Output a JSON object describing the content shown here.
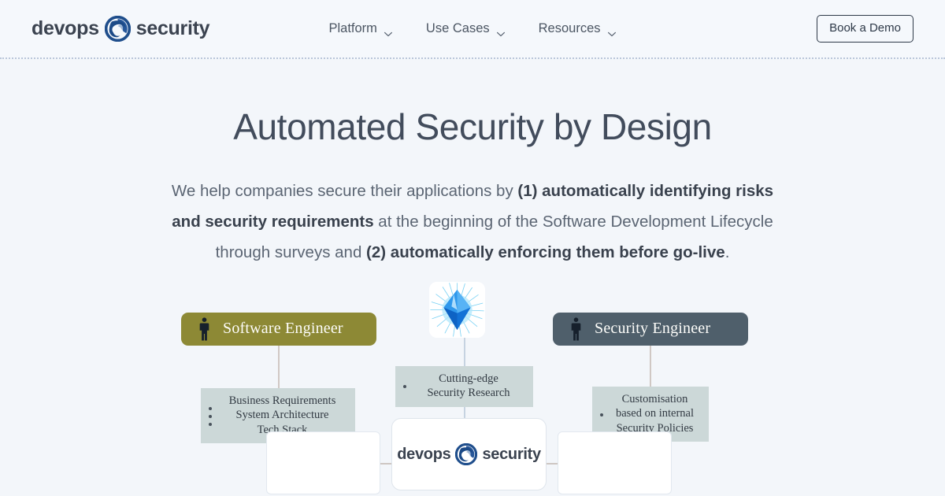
{
  "header": {
    "brand": {
      "left_word": "devops",
      "right_word": "security",
      "mark_icon": "swirl-logo-icon"
    },
    "nav": [
      {
        "label": "Platform",
        "icon": "chevron-down-icon"
      },
      {
        "label": "Use Cases",
        "icon": "chevron-down-icon"
      },
      {
        "label": "Resources",
        "icon": "chevron-down-icon"
      }
    ],
    "cta": {
      "label": "Book a Demo"
    }
  },
  "hero": {
    "title": "Automated Security by Design",
    "subtitle": {
      "part1": "We help companies secure their applications by ",
      "bold1": "(1) automatically identifying risks and security requirements",
      "part2": " at the beginning of the Software Development Lifecycle through surveys and ",
      "bold2": "(2) automatically enforcing them before go-live",
      "part3": "."
    }
  },
  "diagram": {
    "roles": [
      {
        "id": "software-engineer",
        "label": "Software Engineer",
        "color": "#8d8935",
        "icon": "person-icon"
      },
      {
        "id": "security-engineer",
        "label": "Security Engineer",
        "color": "#4f5f6b",
        "icon": "person-icon"
      }
    ],
    "gem": {
      "icon": "blue-gem-icon"
    },
    "notes": {
      "left": {
        "lines": [
          "Business Requirements",
          "System Architecture",
          "Tech Stack"
        ],
        "bullets": 3
      },
      "center": {
        "lines": [
          "Cutting-edge",
          "Security Research"
        ],
        "bullets": 1
      },
      "right": {
        "lines": [
          "Customisation",
          "based on internal",
          "Security Policies"
        ],
        "bullets": 1
      }
    },
    "center_card": {
      "left_word": "devops",
      "right_word": "security",
      "mark_icon": "swirl-logo-icon"
    }
  },
  "colors": {
    "page_background": "#f3f6fa",
    "header_background": "#f5f8fc",
    "brand_blue": "#1f4e8c",
    "text_dark": "#3d4653",
    "olive": "#8d8935",
    "slate": "#4f5f6b",
    "note_fill": "#ccd8d8",
    "connector": "#b9a9a0"
  }
}
